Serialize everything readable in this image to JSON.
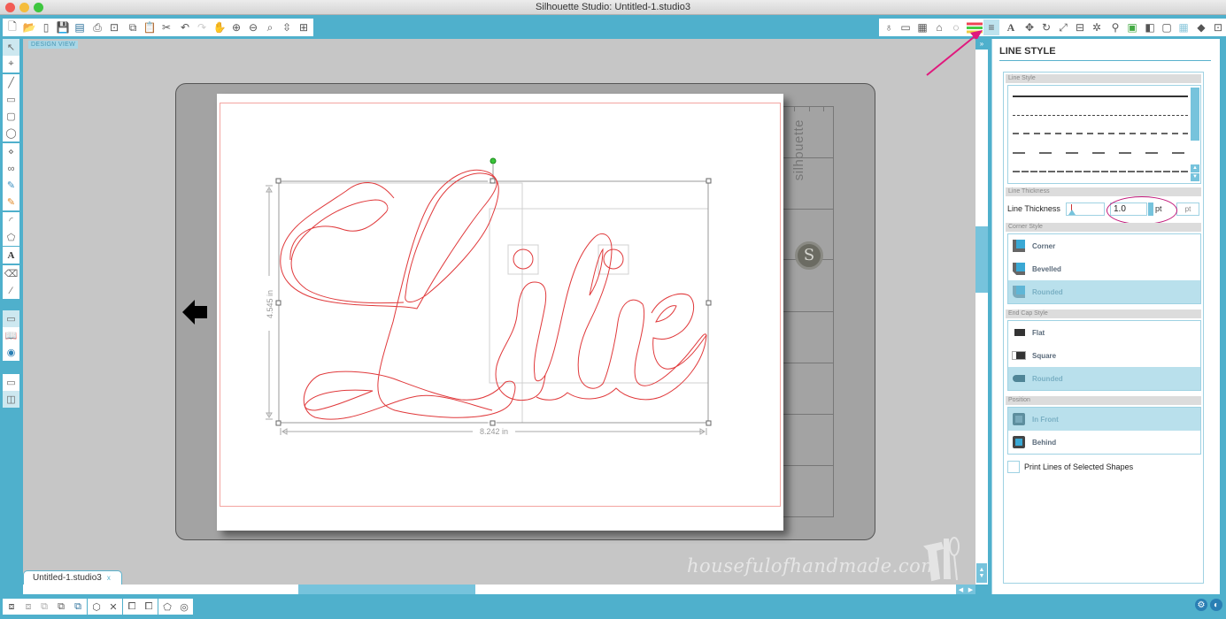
{
  "window": {
    "title": "Silhouette Studio: Untitled-1.studio3"
  },
  "toolbar_top": {
    "file_group": [
      "new-document",
      "open",
      "open-library",
      "save",
      "save-to-library"
    ],
    "print_group": [
      "print",
      "send-to-silhouette"
    ],
    "edit_group": [
      "copy",
      "paste",
      "cut"
    ],
    "history_group": [
      "undo",
      "redo"
    ],
    "view_group": [
      "pan",
      "zoom-in",
      "zoom-out",
      "zoom-select",
      "zoom-drag",
      "fit-to-page"
    ],
    "right_group_1": [
      "fill-color",
      "line-color",
      "fill-pattern",
      "fill-gradient",
      "shadow"
    ],
    "right_group_2": [
      "line-color-panel",
      "line-style-panel"
    ],
    "right_group_3": [
      "text-style"
    ],
    "right_group_4": [
      "transform",
      "rotate",
      "scale",
      "align",
      "replicate"
    ],
    "right_group_5": [
      "trace",
      "offset"
    ],
    "right_group_6": [
      "page-setup",
      "registration-marks",
      "grid"
    ],
    "right_group_7": [
      "cut-settings",
      "send"
    ]
  },
  "canvas": {
    "view_label": "DESIGN VIEW",
    "mat_brand": "silhouette",
    "mat_logo": "S",
    "design_text": "Lilie",
    "height_dim": "4.545 in",
    "width_dim": "8.242 in",
    "watermark": "housefulofhandmade.com"
  },
  "doc_tab": {
    "label": "Untitled-1.studio3",
    "close": "x"
  },
  "panel": {
    "title": "LINE STYLE",
    "line_style": {
      "heading": "Line Style",
      "options": [
        "solid",
        "fine-dash",
        "medium-dash",
        "long-dash",
        "dense-dash"
      ]
    },
    "line_thickness": {
      "heading": "Line Thickness",
      "label": "Line Thickness",
      "value": "1.0",
      "unit": "pt",
      "unit_button": "pt"
    },
    "corner_style": {
      "heading": "Corner Style",
      "options": [
        "Corner",
        "Bevelled",
        "Rounded"
      ],
      "selected": "Rounded"
    },
    "end_cap_style": {
      "heading": "End Cap Style",
      "options": [
        "Flat",
        "Square",
        "Rounded"
      ],
      "selected": "Rounded"
    },
    "position": {
      "heading": "Position",
      "options": [
        "In Front",
        "Behind"
      ],
      "selected": "In Front"
    },
    "print_lines": {
      "label": "Print Lines of Selected Shapes",
      "checked": false
    }
  },
  "colors": {
    "accent": "#4fb0cc",
    "cut_line": "#e0393b",
    "annotation": "#e0197d",
    "selected_row": "#b9e0ec"
  }
}
